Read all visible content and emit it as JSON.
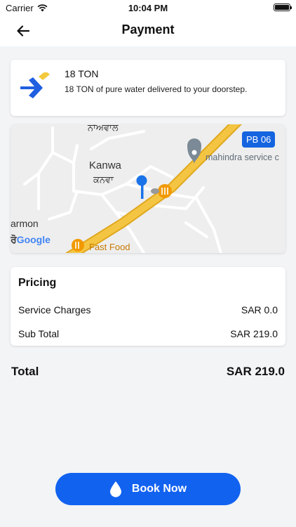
{
  "status_bar": {
    "carrier": "Carrier",
    "time": "10:04 PM"
  },
  "header": {
    "title": "Payment"
  },
  "product": {
    "title": "18 TON",
    "description": "18 TON of pure water delivered to your doorstep."
  },
  "map": {
    "badge": "PB 06",
    "labels": {
      "place_gurmukhi_top": "ਨਾਂਅਵਾਲ",
      "place_kanwa": "Kanwa",
      "place_kanwa_gurmukhi": "ਕਨਵਾ",
      "poi_mahindra": "mahindra service c",
      "place_armon": "armon",
      "poi_fast_food": "Fast Food"
    },
    "google_prefix": "ਰੋ",
    "google_logo": "Google",
    "colors": {
      "road": "#f4c542",
      "road_edge": "#e0a820",
      "pin": "#1a73e8",
      "food_poi": "#f29900",
      "service_poi": "#7b8a96"
    }
  },
  "pricing": {
    "title": "Pricing",
    "service_charges_label": "Service Charges",
    "service_charges_value": "SAR 0.0",
    "subtotal_label": "Sub Total",
    "subtotal_value": "SAR 219.0"
  },
  "total": {
    "label": "Total",
    "value": "SAR 219.0"
  },
  "book_button": {
    "label": "Book Now",
    "icon": "water-drop-icon"
  },
  "colors": {
    "primary": "#1262f0",
    "logo_blue": "#1f5fe0",
    "logo_yellow": "#f3c93d",
    "background": "#f2f4f6"
  }
}
